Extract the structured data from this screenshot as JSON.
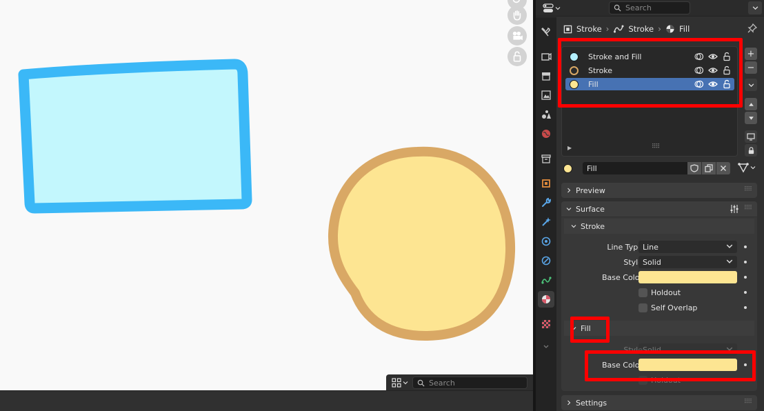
{
  "properties": {
    "search": {
      "placeholder": "Search"
    },
    "breadcrumb": {
      "object": "Stroke",
      "data": "Stroke",
      "material": "Fill"
    },
    "material_slots": [
      {
        "label": "Stroke and Fill",
        "swatch": "#b4f0ff"
      },
      {
        "label": "Stroke",
        "swatch": "#2a2a2a"
      },
      {
        "label": "Fill",
        "swatch": "#fde592",
        "active": true
      }
    ],
    "material_name": "Fill",
    "panels": {
      "preview": "Preview",
      "surface": "Surface",
      "stroke_sub": "Stroke",
      "fill_sub": "Fill",
      "settings": "Settings"
    },
    "stroke": {
      "line_type_label": "Line Type",
      "line_type_value": "Line",
      "style_label": "Style",
      "style_value": "Solid",
      "base_color_label": "Base Color",
      "base_color": "#fde592",
      "holdout_label": "Holdout",
      "self_overlap_label": "Self Overlap"
    },
    "fill": {
      "style_label": "Style",
      "style_value": "Solid",
      "base_color_label": "Base Color",
      "base_color": "#fde592",
      "holdout_label": "Holdout"
    }
  },
  "viewport": {
    "search_placeholder": "Search",
    "shapes": {
      "rect_stroke": "#3bb8f7",
      "rect_fill": "#c3f7fd",
      "circle_stroke": "#d9a865",
      "circle_fill": "#fde592"
    }
  },
  "colors": {
    "accent_selection": "#4772b3",
    "highlight": "#ff0000"
  }
}
